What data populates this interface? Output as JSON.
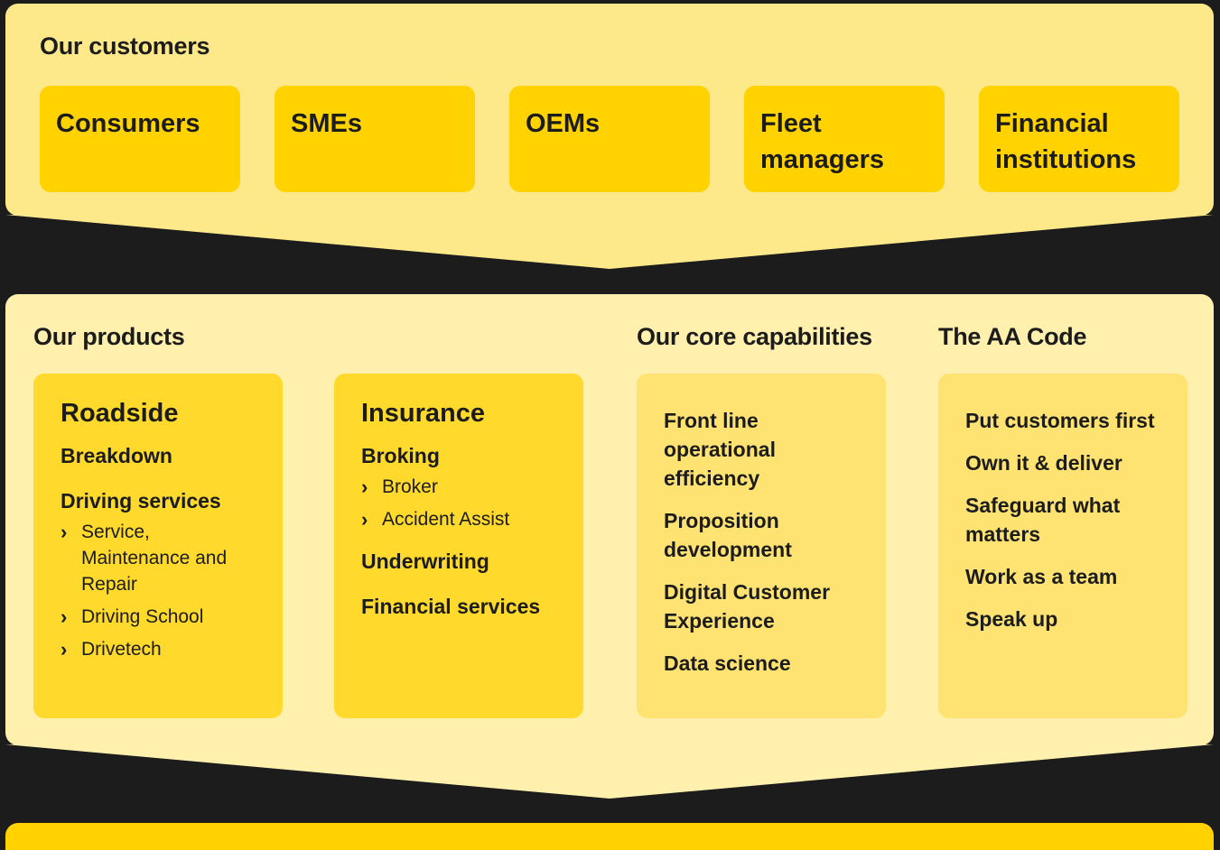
{
  "customers": {
    "title": "Our customers",
    "items": [
      {
        "label": "Consumers"
      },
      {
        "label": "SMEs"
      },
      {
        "label": "OEMs"
      },
      {
        "label": "Fleet managers"
      },
      {
        "label": "Financial institutions"
      }
    ]
  },
  "products": {
    "title": "Our products",
    "roadside": {
      "heading": "Roadside",
      "breakdown": "Breakdown",
      "driving_services": "Driving services",
      "driving_items": [
        "Service, Maintenance and Repair",
        "Driving School",
        "Drivetech"
      ]
    },
    "insurance": {
      "heading": "Insurance",
      "broking": "Broking",
      "broking_items": [
        "Broker",
        "Accident Assist"
      ],
      "underwriting": "Underwriting",
      "financial_services": "Financial services"
    }
  },
  "capabilities": {
    "title": "Our core capabilities",
    "items": [
      "Front line operational efficiency",
      "Proposition development",
      "Digital Customer Experience",
      "Data science"
    ]
  },
  "aa_code": {
    "title": "The AA Code",
    "items": [
      "Put customers first",
      "Own it & deliver",
      "Safeguard what matters",
      "Work as a team",
      "Speak up"
    ]
  },
  "icons": {
    "list_bullet": "chevron-right-icon"
  },
  "colors": {
    "background": "#1c1c1c",
    "panel_light": "#fee98a",
    "panel_pale": "#fff1ad",
    "card_yellow": "#ffd200",
    "card_mid": "#ffd92b",
    "card_light": "#fee372"
  }
}
